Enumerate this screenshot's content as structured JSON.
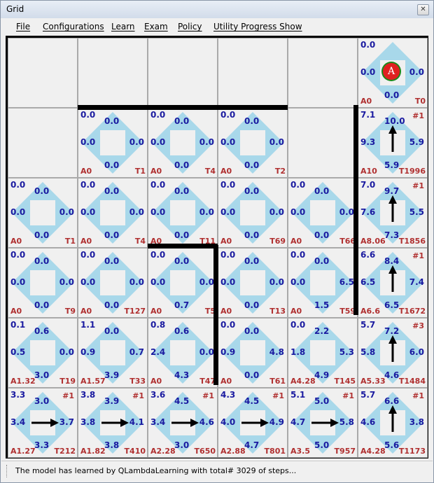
{
  "window": {
    "title": "Grid",
    "close_icon": "close-icon"
  },
  "menu": [
    "File",
    "Configurations",
    "Learn",
    "Exam",
    "Policy",
    "Utility Progress Show"
  ],
  "status": "The model has learned by QLambdaLearning with total# 3029 of steps...",
  "colors": {
    "quad": "#a8d8ea",
    "value": "#1a1aa0",
    "counter": "#b03030"
  },
  "grid": {
    "rows": [
      [
        {
          "empty": true
        },
        {
          "empty": true
        },
        {
          "empty": true
        },
        {
          "empty": true
        },
        {
          "empty": true
        },
        {
          "tl": "0.0",
          "top": "",
          "left": "0.0",
          "right": "0.0",
          "bottom": "0.0",
          "a": "A0",
          "t": "T0",
          "agent": "A"
        }
      ],
      [
        {
          "empty": true
        },
        {
          "tl": "0.0",
          "top": "0.0",
          "left": "0.0",
          "right": "0.0",
          "bottom": "0.0",
          "a": "A0",
          "t": "T1"
        },
        {
          "tl": "0.0",
          "top": "0.0",
          "left": "0.0",
          "right": "0.0",
          "bottom": "0.0",
          "a": "A0",
          "t": "T4"
        },
        {
          "tl": "0.0",
          "top": "0.0",
          "left": "0.0",
          "right": "0.0",
          "bottom": "0.0",
          "a": "A0",
          "t": "T2"
        },
        {
          "empty": true
        },
        {
          "tl": "7.1",
          "top": "10.0",
          "left": "9.3",
          "right": "5.9",
          "bottom": "5.9",
          "a": "A10",
          "t": "T1996",
          "s": "#1",
          "arrow": "up"
        }
      ],
      [
        {
          "tl": "0.0",
          "top": "0.0",
          "left": "0.0",
          "right": "0.0",
          "bottom": "0.0",
          "a": "A0",
          "t": "T1"
        },
        {
          "tl": "0.0",
          "top": "0.0",
          "left": "0.0",
          "right": "0.0",
          "bottom": "0.0",
          "a": "A0",
          "t": "T4"
        },
        {
          "tl": "0.0",
          "top": "0.0",
          "left": "0.0",
          "right": "0.0",
          "bottom": "0.0",
          "a": "A0",
          "t": "T11"
        },
        {
          "tl": "0.0",
          "top": "0.0",
          "left": "0.0",
          "right": "0.0",
          "bottom": "0.0",
          "a": "A0",
          "t": "T69"
        },
        {
          "tl": "0.0",
          "top": "0.0",
          "left": "0.0",
          "right": "0.0",
          "bottom": "0.0",
          "a": "A0",
          "t": "T66"
        },
        {
          "tl": "7.0",
          "top": "9.7",
          "left": "7.6",
          "right": "5.5",
          "bottom": "7.3",
          "a": "A8.06",
          "t": "T1856",
          "s": "#1",
          "arrow": "up"
        }
      ],
      [
        {
          "tl": "0.0",
          "top": "0.0",
          "left": "0.0",
          "right": "0.0",
          "bottom": "0.0",
          "a": "A0",
          "t": "T9"
        },
        {
          "tl": "0.0",
          "top": "0.0",
          "left": "0.0",
          "right": "0.0",
          "bottom": "0.0",
          "a": "A0",
          "t": "T127"
        },
        {
          "tl": "0.0",
          "top": "0.0",
          "left": "0.0",
          "right": "0.0",
          "bottom": "0.7",
          "a": "A0",
          "t": "T5"
        },
        {
          "tl": "0.0",
          "top": "0.0",
          "left": "0.0",
          "right": "0.0",
          "bottom": "0.0",
          "a": "A0",
          "t": "T13"
        },
        {
          "tl": "0.0",
          "top": "0.0",
          "left": "0.0",
          "right": "6.5",
          "bottom": "1.5",
          "a": "A0",
          "t": "T59"
        },
        {
          "tl": "6.6",
          "top": "8.4",
          "left": "6.5",
          "right": "7.4",
          "bottom": "6.5",
          "a": "A6.6",
          "t": "T1672",
          "s": "#1",
          "arrow": "up"
        }
      ],
      [
        {
          "tl": "0.1",
          "top": "0.6",
          "left": "0.5",
          "right": "0.0",
          "bottom": "3.0",
          "a": "A1.32",
          "t": "T19"
        },
        {
          "tl": "1.1",
          "top": "0.0",
          "left": "0.9",
          "right": "0.7",
          "bottom": "3.9",
          "a": "A1.57",
          "t": "T33"
        },
        {
          "tl": "0.8",
          "top": "0.6",
          "left": "2.4",
          "right": "0.0",
          "bottom": "4.3",
          "a": "A0",
          "t": "T47"
        },
        {
          "tl": "0.0",
          "top": "0.0",
          "left": "0.9",
          "right": "4.8",
          "bottom": "0.0",
          "a": "A0",
          "t": "T61"
        },
        {
          "tl": "0.0",
          "top": "2.2",
          "left": "1.8",
          "right": "5.3",
          "bottom": "4.9",
          "a": "A4.28",
          "t": "T145"
        },
        {
          "tl": "5.7",
          "top": "7.2",
          "left": "5.8",
          "right": "6.0",
          "bottom": "4.6",
          "a": "A5.33",
          "t": "T1484",
          "s": "#3",
          "arrow": "up"
        }
      ],
      [
        {
          "tl": "3.3",
          "top": "3.0",
          "left": "3.4",
          "right": "3.7",
          "bottom": "3.3",
          "a": "A1.27",
          "t": "T212",
          "s": "#1",
          "arrow": "right"
        },
        {
          "tl": "3.8",
          "top": "3.9",
          "left": "3.8",
          "right": "4.1",
          "bottom": "3.8",
          "a": "A1.82",
          "t": "T410",
          "s": "#1",
          "arrow": "right"
        },
        {
          "tl": "3.6",
          "top": "4.5",
          "left": "3.4",
          "right": "4.6",
          "bottom": "3.0",
          "a": "A2.28",
          "t": "T650",
          "s": "#1",
          "arrow": "right"
        },
        {
          "tl": "4.3",
          "top": "4.5",
          "left": "4.0",
          "right": "4.9",
          "bottom": "4.7",
          "a": "A2.88",
          "t": "T801",
          "s": "#1",
          "arrow": "right"
        },
        {
          "tl": "5.1",
          "top": "5.0",
          "left": "4.7",
          "right": "5.8",
          "bottom": "5.0",
          "a": "A3.5",
          "t": "T957",
          "s": "#1",
          "arrow": "right"
        },
        {
          "tl": "5.7",
          "top": "6.6",
          "left": "4.6",
          "right": "3.8",
          "bottom": "5.6",
          "a": "A4.28",
          "t": "T1173",
          "s": "#1",
          "arrow": "up"
        }
      ]
    ]
  }
}
